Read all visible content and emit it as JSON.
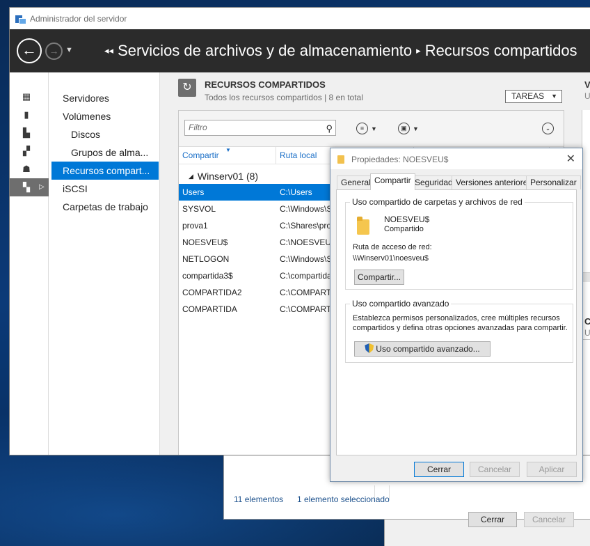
{
  "window": {
    "title": "Administrador del servidor"
  },
  "navbar": {
    "back_label": "←",
    "forward_label": "→",
    "dropdown_glyph": "▼",
    "breadcrumb_arrow": "◂◂",
    "crumb_1": "Servicios de archivos y de almacenamiento",
    "crumb_sep": "▸",
    "crumb_2": "Recursos compartidos"
  },
  "iconbar": {
    "items": [
      {
        "name": "dashboard-icon",
        "glyph": "▦"
      },
      {
        "name": "local-server-icon",
        "glyph": "▮"
      },
      {
        "name": "all-servers-icon",
        "glyph": "▙"
      },
      {
        "name": "ad-ds-icon",
        "glyph": "▞"
      },
      {
        "name": "dns-icon",
        "glyph": "☗"
      },
      {
        "name": "file-storage-icon",
        "glyph": "▚"
      }
    ],
    "active_caret": "▷"
  },
  "nav": {
    "items": [
      {
        "label": "Servidores",
        "sub": false,
        "active": false
      },
      {
        "label": "Volúmenes",
        "sub": false,
        "active": false
      },
      {
        "label": "Discos",
        "sub": true,
        "active": false
      },
      {
        "label": "Grupos de alma...",
        "sub": true,
        "active": false
      },
      {
        "label": "Recursos compart...",
        "sub": false,
        "active": true
      },
      {
        "label": "iSCSI",
        "sub": false,
        "active": false
      },
      {
        "label": "Carpetas de trabajo",
        "sub": false,
        "active": false
      }
    ]
  },
  "section": {
    "icon_glyph": "↻",
    "title": "RECURSOS COMPARTIDOS",
    "subtitle": "Todos los recursos compartidos | 8 en total",
    "tasks_label": "TAREAS",
    "tasks_glyph": "▼",
    "right_head": "V",
    "right_sub": "U",
    "right_head2": "C",
    "right_sub2": "U"
  },
  "toolbar": {
    "filter_placeholder": "Filtro",
    "search_glyph": "⚲",
    "view_glyph": "≡",
    "save_glyph": "▣",
    "dropdown_glyph": "▼",
    "expand_glyph": "⌄"
  },
  "table": {
    "columns": [
      "Compartir",
      "Ruta local"
    ],
    "sort_glyph": "▼",
    "group_label": "Winserv01 (8)",
    "group_glyph": "◢",
    "rows": [
      {
        "share": "Users",
        "path": "C:\\Users",
        "selected": true
      },
      {
        "share": "SYSVOL",
        "path": "C:\\Windows\\S",
        "selected": false
      },
      {
        "share": "prova1",
        "path": "C:\\Shares\\pro",
        "selected": false
      },
      {
        "share": "NOESVEU$",
        "path": "C:\\NOESVEU$",
        "selected": false
      },
      {
        "share": "NETLOGON",
        "path": "C:\\Windows\\S",
        "selected": false
      },
      {
        "share": "compartida3$",
        "path": "C:\\compartida",
        "selected": false
      },
      {
        "share": "COMPARTIDA2",
        "path": "C:\\COMPARTI",
        "selected": false
      },
      {
        "share": "COMPARTIDA",
        "path": "C:\\COMPARTI",
        "selected": false
      }
    ]
  },
  "dialog": {
    "title": "Propiedades: NOESVEU$",
    "close_glyph": "✕",
    "tabs": [
      "General",
      "Compartir",
      "Seguridad",
      "Versiones anteriores",
      "Personalizar"
    ],
    "active_tab": "Compartir",
    "network_group": {
      "legend": "Uso compartido de carpetas y archivos de red",
      "share_name": "NOESVEU$",
      "share_state": "Compartido",
      "path_label": "Ruta de acceso de red:",
      "path_value": "\\\\Winserv01\\noesveu$",
      "share_button": "Compartir..."
    },
    "advanced_group": {
      "legend": "Uso compartido avanzado",
      "description_line1": "Establezca permisos personalizados, cree múltiples recursos",
      "description_line2": "compartidos y defina otras opciones avanzadas para compartir.",
      "button": "Uso compartido avanzado..."
    },
    "buttons": {
      "close": "Cerrar",
      "cancel": "Cancelar",
      "apply": "Aplicar"
    }
  },
  "background_window": {
    "items_count": "11 elementos",
    "selected_count": "1 elemento seleccionado",
    "close": "Cerrar",
    "cancel": "Cancelar"
  }
}
